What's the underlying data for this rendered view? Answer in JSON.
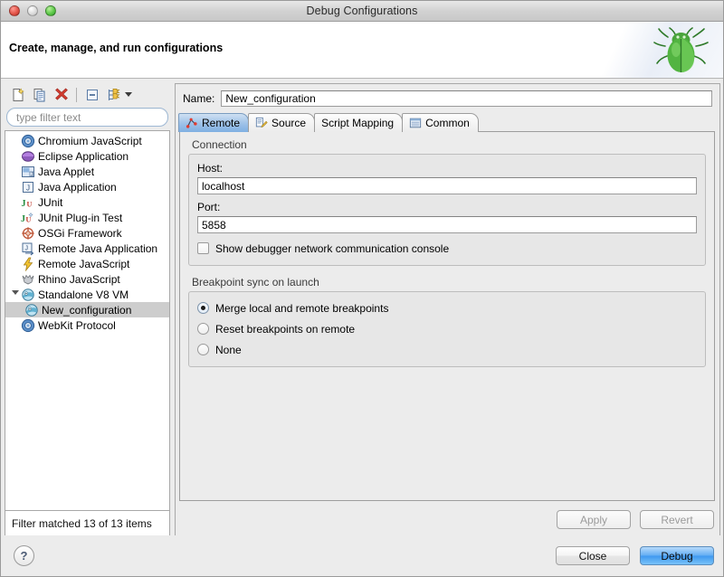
{
  "window": {
    "title": "Debug Configurations",
    "traffic_lights": [
      "close-button",
      "minimize-button",
      "zoom-button"
    ]
  },
  "banner": {
    "headline": "Create, manage, and run configurations",
    "icon": "green-bug-icon"
  },
  "left_panel": {
    "toolbar": [
      {
        "name": "new-configuration-icon",
        "label": "New launch configuration"
      },
      {
        "name": "duplicate-configuration-icon",
        "label": "Duplicate"
      },
      {
        "name": "delete-configuration-icon",
        "label": "Delete"
      },
      {
        "name": "collapse-all-icon",
        "label": "Collapse All"
      },
      {
        "name": "filter-icon",
        "label": "Filter"
      }
    ],
    "filter": {
      "placeholder": "type filter text",
      "value": ""
    },
    "tree": [
      {
        "label": "Chromium JavaScript",
        "icon": "chromium-icon",
        "depth": 0,
        "selected": false,
        "twisty": ""
      },
      {
        "label": "Eclipse Application",
        "icon": "eclipse-icon",
        "depth": 0,
        "selected": false,
        "twisty": ""
      },
      {
        "label": "Java Applet",
        "icon": "java-applet-icon",
        "depth": 0,
        "selected": false,
        "twisty": ""
      },
      {
        "label": "Java Application",
        "icon": "java-application-icon",
        "depth": 0,
        "selected": false,
        "twisty": ""
      },
      {
        "label": "JUnit",
        "icon": "junit-icon",
        "depth": 0,
        "selected": false,
        "twisty": ""
      },
      {
        "label": "JUnit Plug-in Test",
        "icon": "junit-plugin-icon",
        "depth": 0,
        "selected": false,
        "twisty": ""
      },
      {
        "label": "OSGi Framework",
        "icon": "osgi-icon",
        "depth": 0,
        "selected": false,
        "twisty": ""
      },
      {
        "label": "Remote Java Application",
        "icon": "remote-java-icon",
        "depth": 0,
        "selected": false,
        "twisty": ""
      },
      {
        "label": "Remote JavaScript",
        "icon": "remote-javascript-icon",
        "depth": 0,
        "selected": false,
        "twisty": ""
      },
      {
        "label": "Rhino JavaScript",
        "icon": "rhino-icon",
        "depth": 0,
        "selected": false,
        "twisty": ""
      },
      {
        "label": "Standalone V8 VM",
        "icon": "v8-icon",
        "depth": 0,
        "selected": false,
        "twisty": "expanded"
      },
      {
        "label": "New_configuration",
        "icon": "v8-icon",
        "depth": 1,
        "selected": true,
        "twisty": ""
      },
      {
        "label": "WebKit Protocol",
        "icon": "webkit-icon",
        "depth": 0,
        "selected": false,
        "twisty": ""
      }
    ],
    "status": "Filter matched 13 of 13 items"
  },
  "right_panel": {
    "name_label": "Name:",
    "name_value": "New_configuration",
    "tabs": [
      {
        "label": "Remote",
        "icon": "remote-debug-icon",
        "active": true
      },
      {
        "label": "Source",
        "icon": "source-lookup-icon",
        "active": false
      },
      {
        "label": "Script Mapping",
        "icon": "",
        "active": false
      },
      {
        "label": "Common",
        "icon": "common-tab-icon",
        "active": false
      }
    ],
    "connection": {
      "title": "Connection",
      "host_label": "Host:",
      "host_value": "localhost",
      "port_label": "Port:",
      "port_value": "5858",
      "console_checkbox_label": "Show debugger network communication console",
      "console_checked": false
    },
    "breakpoints": {
      "title": "Breakpoint sync on launch",
      "options": [
        {
          "label": "Merge local and remote breakpoints",
          "selected": true
        },
        {
          "label": "Reset breakpoints on remote",
          "selected": false
        },
        {
          "label": "None",
          "selected": false
        }
      ]
    },
    "apply_label": "Apply",
    "revert_label": "Revert",
    "apply_enabled": false,
    "revert_enabled": false
  },
  "footer": {
    "help_label": "?",
    "close_label": "Close",
    "debug_label": "Debug"
  },
  "colors": {
    "accent_blue": "#3f99f0",
    "active_tab_blue": "#9dc1e8",
    "selection_gray": "#cdcdcd",
    "window_gray": "#ececec"
  }
}
